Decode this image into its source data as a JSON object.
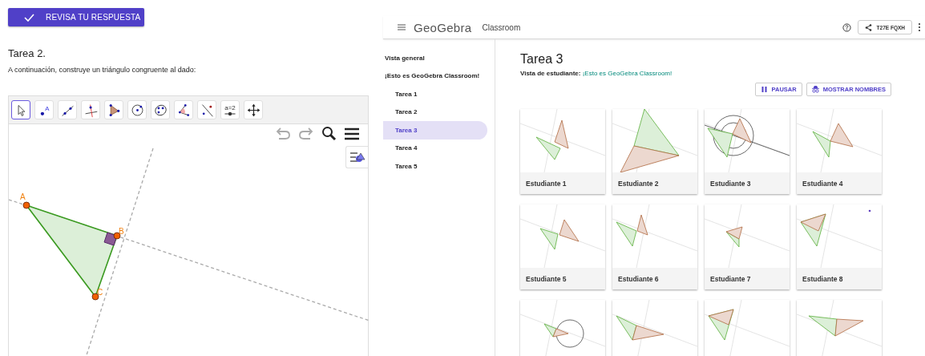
{
  "left": {
    "check_button": {
      "label": "REVISA TU RESPUESTA"
    },
    "task_title": "Tarea 2.",
    "instructions": "A continuación, construye un triángulo congruente al dado:",
    "applet": {
      "tools": [
        {
          "kind": "pointer",
          "selected": true
        },
        {
          "kind": "point",
          "glyph": "A",
          "selected": false
        },
        {
          "kind": "line",
          "selected": false
        },
        {
          "kind": "perpendicular",
          "selected": false
        },
        {
          "kind": "polygon",
          "selected": false
        },
        {
          "kind": "circle",
          "selected": false
        },
        {
          "kind": "conic",
          "selected": false
        },
        {
          "kind": "angle",
          "selected": false
        },
        {
          "kind": "reflect",
          "selected": false
        },
        {
          "kind": "slider",
          "glyph": "a=2",
          "selected": false
        },
        {
          "kind": "pan",
          "selected": false
        }
      ],
      "points": [
        {
          "label": "A"
        },
        {
          "label": "B"
        },
        {
          "label": "C"
        }
      ]
    }
  },
  "right": {
    "header": {
      "logo": "GeoGebra",
      "product": "Classroom",
      "share_code": "T27E FQXH"
    },
    "sidebar": {
      "items": [
        {
          "label": "Vista general",
          "selected": false
        },
        {
          "label": "¡Esto es GeoGebra Classroom!",
          "selected": false,
          "children": [
            {
              "label": "Tarea 1",
              "selected": false
            },
            {
              "label": "Tarea 2",
              "selected": false
            },
            {
              "label": "Tarea 3",
              "selected": true
            },
            {
              "label": "Tarea 4",
              "selected": false
            },
            {
              "label": "Tarea 5",
              "selected": false
            }
          ]
        }
      ]
    },
    "main": {
      "title": "Tarea 3",
      "subtitle_label": "Vista de estudiante:",
      "subtitle_link": "¡Esto es GeoGebra Classroom!",
      "buttons": [
        {
          "kind": "pause",
          "label": "PAUSAR"
        },
        {
          "kind": "names",
          "label": "MOSTRAR NOMBRES"
        }
      ],
      "cards": [
        {
          "kind": "labeled",
          "label": "Estudiante 1"
        },
        {
          "kind": "labeled",
          "label": "Estudiante 2"
        },
        {
          "kind": "labeled",
          "label": "Estudiante 3"
        },
        {
          "kind": "labeled",
          "label": "Estudiante 4"
        },
        {
          "kind": "labeled",
          "label": "Estudiante 5"
        },
        {
          "kind": "labeled",
          "label": "Estudiante 6"
        },
        {
          "kind": "labeled",
          "label": "Estudiante 7"
        },
        {
          "kind": "labeled",
          "label": "Estudiante 8"
        },
        {
          "kind": "unlabeled"
        },
        {
          "kind": "unlabeled"
        },
        {
          "kind": "unlabeled"
        },
        {
          "kind": "unlabeled"
        }
      ]
    }
  }
}
